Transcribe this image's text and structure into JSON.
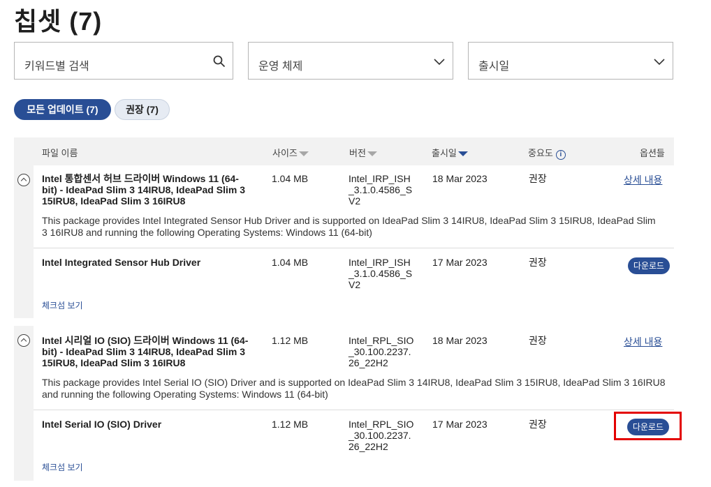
{
  "page": {
    "title": "칩셋 (7)"
  },
  "filters": {
    "keyword_placeholder": "키워드별 검색",
    "os_placeholder": "운영 체제",
    "date_placeholder": "출시일"
  },
  "tabs": {
    "all": "모든 업데이트 (7)",
    "recommended": "권장 (7)"
  },
  "columns": {
    "file_name": "파일 이름",
    "size": "사이즈",
    "version": "버전",
    "release_date": "출시일",
    "importance": "중요도",
    "options": "옵션들"
  },
  "packages": [
    {
      "name": "Intel 통합센서 허브 드라이버 Windows 11 (64-bit) - IdeaPad Slim 3 14IRU8, IdeaPad Slim 3 15IRU8, IdeaPad Slim 3 16IRU8",
      "size": "1.04 MB",
      "version": "Intel_IRP_ISH_3.1.0.4586_SV2",
      "date": "18 Mar 2023",
      "importance": "권장",
      "details_link": "상세 내용",
      "description": "This package provides Intel Integrated Sensor Hub Driver and is supported on IdeaPad Slim 3 14IRU8, IdeaPad Slim 3 15IRU8, IdeaPad Slim 3 16IRU8 and running the following Operating Systems: Windows 11 (64-bit)",
      "file": {
        "name": "Intel Integrated Sensor Hub Driver",
        "size": "1.04 MB",
        "version": "Intel_IRP_ISH_3.1.0.4586_SV2",
        "date": "17 Mar 2023",
        "importance": "권장",
        "download": "다운로드",
        "checksum": "체크섬 보기"
      }
    },
    {
      "name": "Intel 시리얼 IO (SIO) 드라이버 Windows 11 (64-bit) - IdeaPad Slim 3 14IRU8, IdeaPad Slim 3 15IRU8, IdeaPad Slim 3 16IRU8",
      "size": "1.12 MB",
      "version": "Intel_RPL_SIO_30.100.2237.26_22H2",
      "date": "18 Mar 2023",
      "importance": "권장",
      "details_link": "상세 내용",
      "description": "This package provides Intel Serial IO (SIO) Driver and is supported on IdeaPad Slim 3 14IRU8, IdeaPad Slim 3 15IRU8, IdeaPad Slim 3 16IRU8 and running the following Operating Systems: Windows 11 (64-bit)",
      "file": {
        "name": "Intel Serial IO (SIO) Driver",
        "size": "1.12 MB",
        "version": "Intel_RPL_SIO_30.100.2237.26_22H2",
        "date": "17 Mar 2023",
        "importance": "권장",
        "download": "다운로드",
        "checksum": "체크섬 보기"
      }
    }
  ],
  "colors": {
    "accent": "#294e95",
    "highlight": "#e30000"
  }
}
